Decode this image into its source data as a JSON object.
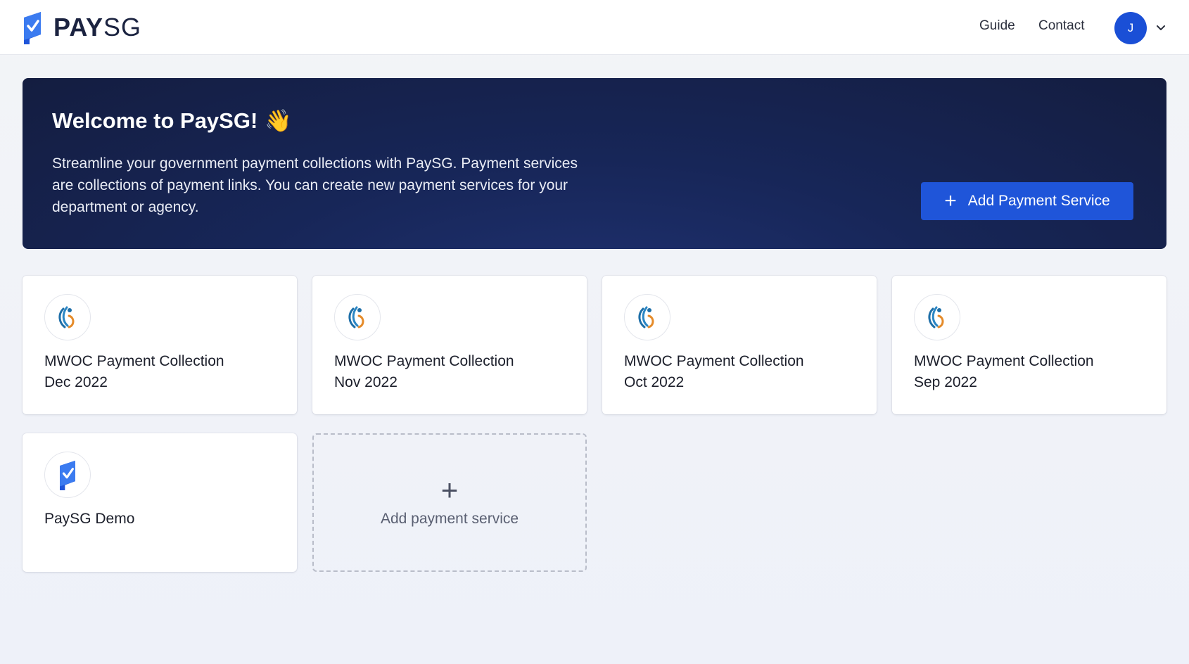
{
  "header": {
    "brand_bold": "PAY",
    "brand_light": "SG",
    "nav": [
      "Guide",
      "Contact"
    ],
    "avatar_initial": "J"
  },
  "hero": {
    "title": "Welcome to PaySG!",
    "wave_emoji": "👋",
    "description": "Streamline your government payment collections with PaySG. Payment services are collections of payment links. You can create new payment services for your department or agency.",
    "cta_label": "Add Payment Service"
  },
  "services": [
    {
      "name_line1": "MWOC Payment Collection",
      "name_line2": "Dec 2022",
      "icon": "mwoc-logo-icon"
    },
    {
      "name_line1": "MWOC Payment Collection",
      "name_line2": "Nov 2022",
      "icon": "mwoc-logo-icon"
    },
    {
      "name_line1": "MWOC Payment Collection",
      "name_line2": "Oct 2022",
      "icon": "mwoc-logo-icon"
    },
    {
      "name_line1": "MWOC Payment Collection",
      "name_line2": "Sep 2022",
      "icon": "mwoc-logo-icon"
    },
    {
      "name_line1": "PaySG Demo",
      "name_line2": "",
      "icon": "paysg-logo-icon"
    }
  ],
  "add_card": {
    "label": "Add payment service"
  },
  "colors": {
    "primary": "#1f55d9",
    "hero_bg": "#172658",
    "brand_text": "#1b2340"
  }
}
